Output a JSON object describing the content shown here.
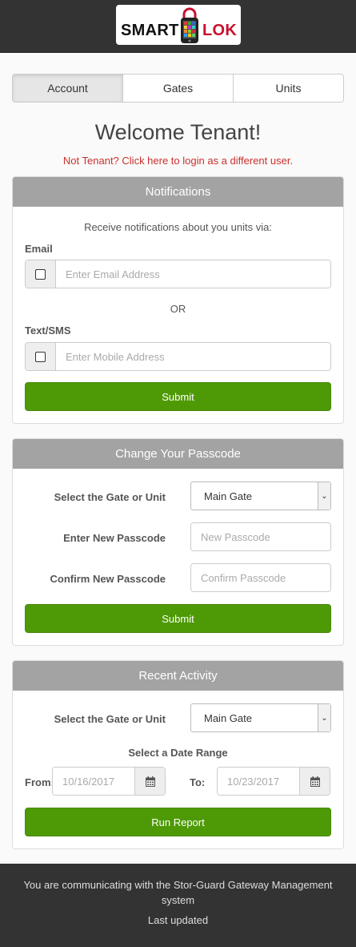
{
  "brand": {
    "name_left": "SMART",
    "name_right": "LOK",
    "logo_icon": "phone-padlock-icon",
    "accent": "#c8102e"
  },
  "tabs": [
    {
      "label": "Account",
      "active": true
    },
    {
      "label": "Gates",
      "active": false
    },
    {
      "label": "Units",
      "active": false
    }
  ],
  "welcome": {
    "title": "Welcome Tenant!",
    "switch_user": "Not Tenant? Click here to login as a different user."
  },
  "notifications": {
    "heading": "Notifications",
    "intro": "Receive notifications about you units via:",
    "email_label": "Email",
    "email_placeholder": "Enter Email Address",
    "email_checked": false,
    "or": "OR",
    "sms_label": "Text/SMS",
    "sms_placeholder": "Enter Mobile Address",
    "sms_checked": false,
    "submit": "Submit"
  },
  "passcode": {
    "heading": "Change Your Passcode",
    "select_label": "Select the Gate or Unit",
    "select_value": "Main Gate",
    "new_label": "Enter New Passcode",
    "new_placeholder": "New Passcode",
    "confirm_label": "Confirm New Passcode",
    "confirm_placeholder": "Confirm Passcode",
    "submit": "Submit"
  },
  "activity": {
    "heading": "Recent Activity",
    "select_label": "Select the Gate or Unit",
    "select_value": "Main Gate",
    "range_label": "Select a Date Range",
    "from_label": "From:",
    "from_placeholder": "10/16/2017",
    "to_label": "To:",
    "to_placeholder": "10/23/2017",
    "run": "Run Report"
  },
  "footer": {
    "message": "You are communicating with the Stor-Guard Gateway Management system",
    "updated": "Last updated"
  },
  "colors": {
    "header_bg": "#333333",
    "panel_head": "#a3a3a3",
    "button_green": "#4e9a06",
    "link_red": "#c9302c"
  }
}
